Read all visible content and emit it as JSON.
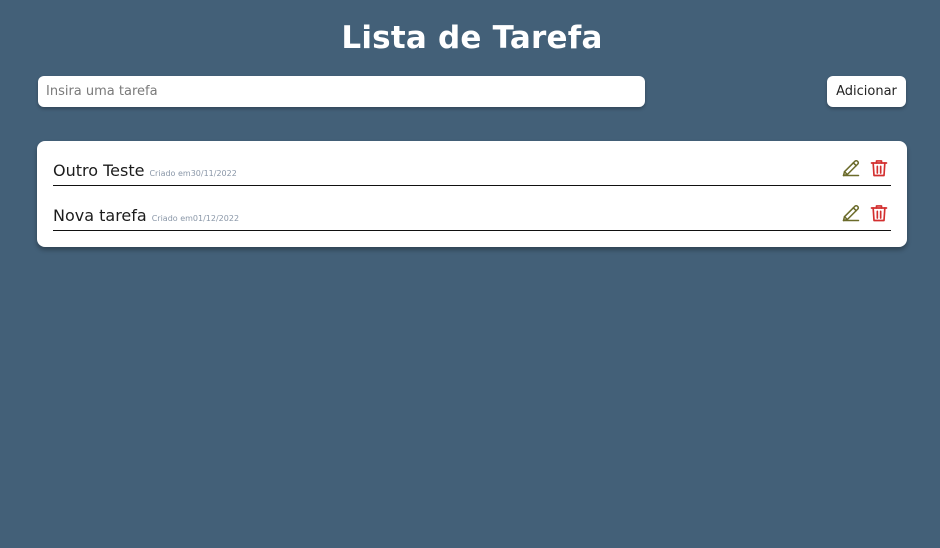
{
  "header": {
    "title": "Lista de Tarefa"
  },
  "form": {
    "input_placeholder": "Insira uma tarefa",
    "input_value": "",
    "add_label": "Adicionar"
  },
  "tasks": [
    {
      "name": "Outro Teste",
      "created": "Criado em30/11/2022",
      "edit_icon": "pencil-icon",
      "delete_icon": "trash-icon"
    },
    {
      "name": "Nova tarefa",
      "created": "Criado em01/12/2022",
      "edit_icon": "pencil-icon",
      "delete_icon": "trash-icon"
    }
  ],
  "colors": {
    "background": "#436078",
    "card": "#ffffff",
    "edit_icon": "#6b6b2a",
    "delete_icon": "#d32f2f"
  }
}
